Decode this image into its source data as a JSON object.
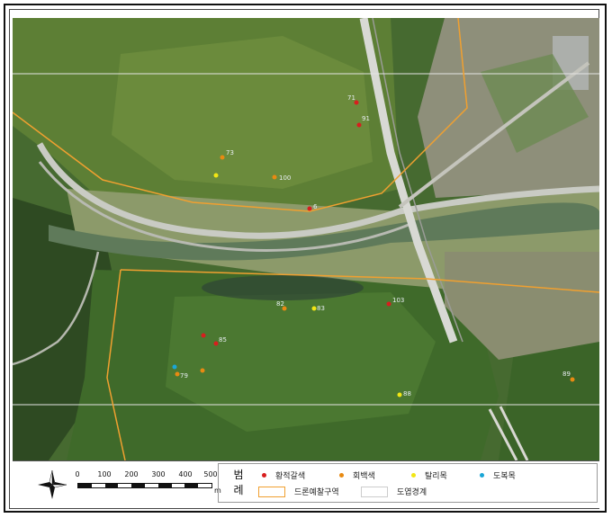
{
  "map": {
    "point_labels": {
      "p1": "71",
      "p2": "91",
      "p3": "73",
      "p4": "100",
      "p5": "6",
      "p6": "82",
      "p7": "103",
      "p8": "83",
      "p9": "85",
      "p10": "79",
      "p11": "88",
      "p12": "89"
    }
  },
  "scale": {
    "ticks": [
      "0",
      "100",
      "200",
      "300",
      "400",
      "500"
    ],
    "unit": "m"
  },
  "legend": {
    "title_line1": "범",
    "title_line2": "례",
    "items": [
      {
        "label": "황적갈색",
        "color": "#d81e1e"
      },
      {
        "label": "회백색",
        "color": "#e88a12"
      },
      {
        "label": "탈리목",
        "color": "#f2e614"
      },
      {
        "label": "도복목",
        "color": "#1aa6d6"
      }
    ],
    "areas": [
      {
        "label": "드론예찰구역",
        "color": "#f0a030"
      },
      {
        "label": "도엽경계",
        "color": "#cccccc"
      }
    ]
  }
}
